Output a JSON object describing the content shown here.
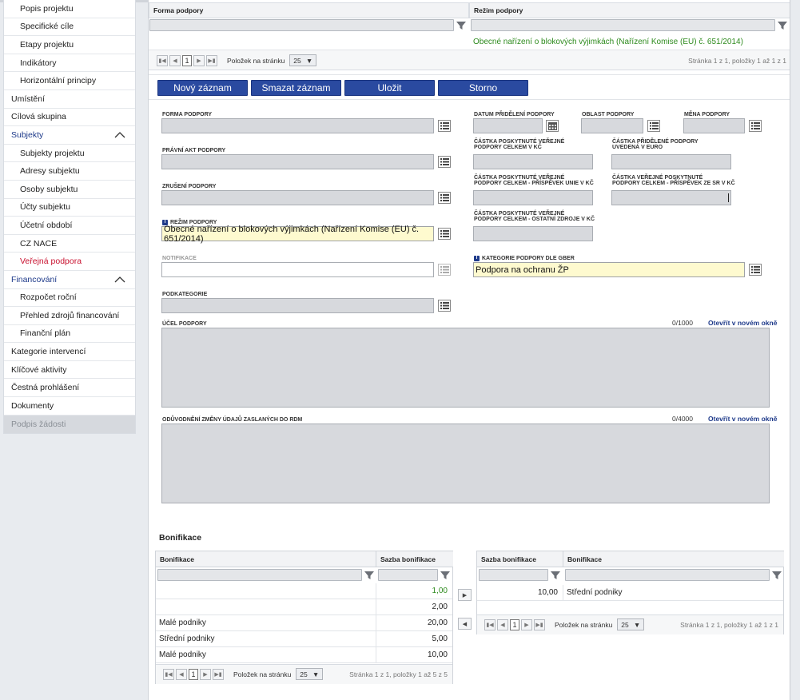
{
  "sidebar": {
    "items": [
      {
        "label": "Popis projektu",
        "type": "sub"
      },
      {
        "label": "Specifické cíle",
        "type": "sub"
      },
      {
        "label": "Etapy projektu",
        "type": "sub"
      },
      {
        "label": "Indikátory",
        "type": "sub"
      },
      {
        "label": "Horizontální principy",
        "type": "sub"
      },
      {
        "label": "Umístění",
        "type": "top"
      },
      {
        "label": "Cílová skupina",
        "type": "top"
      },
      {
        "label": "Subjekty",
        "type": "section"
      },
      {
        "label": "Subjekty projektu",
        "type": "sub"
      },
      {
        "label": "Adresy subjektu",
        "type": "sub"
      },
      {
        "label": "Osoby subjektu",
        "type": "sub"
      },
      {
        "label": "Účty subjektu",
        "type": "sub"
      },
      {
        "label": "Účetní období",
        "type": "sub"
      },
      {
        "label": "CZ NACE",
        "type": "sub"
      },
      {
        "label": "Veřejná podpora",
        "type": "active"
      },
      {
        "label": "Financování",
        "type": "section"
      },
      {
        "label": "Rozpočet roční",
        "type": "sub"
      },
      {
        "label": "Přehled zdrojů financování",
        "type": "sub"
      },
      {
        "label": "Finanční plán",
        "type": "sub"
      },
      {
        "label": "Kategorie intervencí",
        "type": "top"
      },
      {
        "label": "Klíčové aktivity",
        "type": "top"
      },
      {
        "label": "Čestná prohlášení",
        "type": "top"
      },
      {
        "label": "Dokumenty",
        "type": "top"
      },
      {
        "label": "Podpis žádosti",
        "type": "disabled"
      }
    ]
  },
  "top_grid": {
    "col1": "Forma podpory",
    "col2": "Režim podpory",
    "row_value": "Obecné nařízení o blokových výjimkách (Nařízení Komise (EU) č. 651/2014)",
    "row_color": "#2e8b1e",
    "pager": {
      "page": "1",
      "per_page_label": "Položek na stránku",
      "per_page": "25",
      "info": "Stránka 1 z 1, položky 1 až 1 z 1"
    }
  },
  "toolbar": {
    "new": "Nový záznam",
    "delete": "Smazat záznam",
    "save": "Uložit",
    "cancel": "Storno"
  },
  "form": {
    "forma_podpory": {
      "label": "FORMA PODPORY",
      "value": ""
    },
    "pravni_akt": {
      "label": "PRÁVNÍ AKT PODPORY",
      "value": ""
    },
    "zruseni": {
      "label": "ZRUŠENÍ PODPORY",
      "value": ""
    },
    "rezim": {
      "label": "REŽIM PODPORY",
      "value": "Obecné nařízení o blokových výjimkách (Nařízení Komise (EU) č. 651/2014)"
    },
    "notifikace": {
      "label": "NOTIFIKACE",
      "value": ""
    },
    "podkategorie": {
      "label": "PODKATEGORIE",
      "value": ""
    },
    "datum": {
      "label": "DATUM PŘIDĚLENÍ PODPORY",
      "value": ""
    },
    "oblast": {
      "label": "OBLAST PODPORY",
      "value": ""
    },
    "mena": {
      "label": "MĚNA PODPORY",
      "value": ""
    },
    "castka_kc": {
      "label1": "ČÁSTKA POSKYTNUTÉ VEŘEJNÉ",
      "label2": "PODPORY CELKEM V KČ",
      "value": ""
    },
    "castka_euro": {
      "label1": "ČÁSTKA PŘIDĚLENÉ PODPORY",
      "label2": "UVEDENÁ V EURO",
      "value": ""
    },
    "castka_unie": {
      "label1": "ČÁSTKA POSKYTNUTÉ VEŘEJNÉ",
      "label2": "PODPORY CELKEM - PŘÍSPĚVEK UNIE V KČ",
      "value": ""
    },
    "castka_sr": {
      "label1": "ČÁSTKA VEŘEJNÉ POSKYTNUTÉ",
      "label2": "PODPORY CELKEM - PŘÍSPĚVEK ZE SR V KČ",
      "value": ""
    },
    "castka_ostatni": {
      "label1": "ČÁSTKA POSKYTNUTÉ VEŘEJNÉ",
      "label2": "PODPORY CELKEM - OSTATNÍ ZDROJE V KČ",
      "value": ""
    },
    "kategorie_gber": {
      "label": "KATEGORIE PODPORY DLE GBER",
      "value": "Podpora na ochranu ŽP"
    },
    "ucel": {
      "label": "ÚČEL PODPORY",
      "counter": "0/1000",
      "link": "Otevřít v novém okně"
    },
    "oduvodneni": {
      "label": "ODŮVODNĚNÍ ZMĚNY ÚDAJŮ ZASLANÝCH DO RDM",
      "counter": "0/4000",
      "link": "Otevřít v novém okně"
    }
  },
  "bonifikace": {
    "title": "Bonifikace",
    "left": {
      "col1": "Bonifikace",
      "col2": "Sazba bonifikace",
      "rows": [
        {
          "name": "",
          "rate": "1,00",
          "highlight": true
        },
        {
          "name": "",
          "rate": "2,00",
          "highlight": false
        },
        {
          "name": "Malé podniky",
          "rate": "20,00",
          "highlight": false
        },
        {
          "name": "Střední podniky",
          "rate": "5,00",
          "highlight": false
        },
        {
          "name": "Malé podniky",
          "rate": "10,00",
          "highlight": false
        }
      ],
      "pager": {
        "page": "1",
        "per_page_label": "Položek na stránku",
        "per_page": "25",
        "info": "Stránka 1 z 1, položky 1 až 5 z 5"
      }
    },
    "right": {
      "col1": "Sazba bonifikace",
      "col2": "Bonifikace",
      "rows": [
        {
          "rate": "10,00",
          "name": "Střední podniky"
        }
      ],
      "pager": {
        "page": "1",
        "per_page_label": "Položek na stránku",
        "per_page": "25",
        "info": "Stránka 1 z 1, položky 1 až 1 z 1"
      }
    }
  },
  "colors": {
    "accent": "#2a4aa0",
    "active_nav": "#c8102e",
    "green_value": "#2e8b1e"
  }
}
